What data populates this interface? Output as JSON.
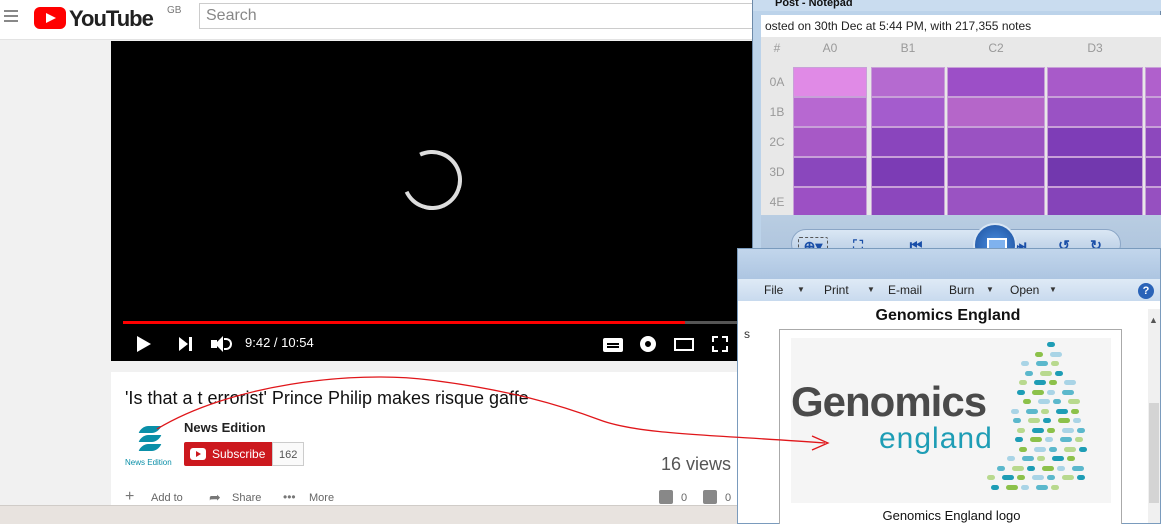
{
  "youtube": {
    "logo_text": "YouTube",
    "region": "GB",
    "search_placeholder": "Search"
  },
  "player": {
    "time": "9:42 / 10:54",
    "progress_fraction": 0.89
  },
  "video": {
    "title": "'Is that a t errorist' Prince Philip makes risque gaffe",
    "channel": "News Edition",
    "channel_logo_caption": "News Edition",
    "subscribe_label": "Subscribe",
    "subscriber_count": "162",
    "views": "16 views",
    "add_to": "Add to",
    "share": "Share",
    "more": "More",
    "likes": "0",
    "dislikes": "0"
  },
  "notepad": {
    "title": "Post - Notepad",
    "subtitle": "osted on 30th Dec at 5:44 PM, with 217,355 notes",
    "col_headers": [
      "#",
      "A0",
      "B1",
      "C2",
      "D3"
    ],
    "row_headers": [
      "0A",
      "1B",
      "2C",
      "3D",
      "4E"
    ]
  },
  "photo_viewer": {
    "menu": [
      "File",
      "Print",
      "E-mail",
      "Burn",
      "Open"
    ],
    "help_label": "?",
    "heading": "Genomics England",
    "logo_word1": "Genomics",
    "logo_word2": "england",
    "caption": "Genomics England logo",
    "side_text": "s"
  },
  "colors": {
    "youtube_red": "#ff0000",
    "subscribe_red": "#cc181e",
    "grid_purple": "#a855c8",
    "genomics_teal": "#1e9db5",
    "annotation_red": "#e0161a"
  }
}
